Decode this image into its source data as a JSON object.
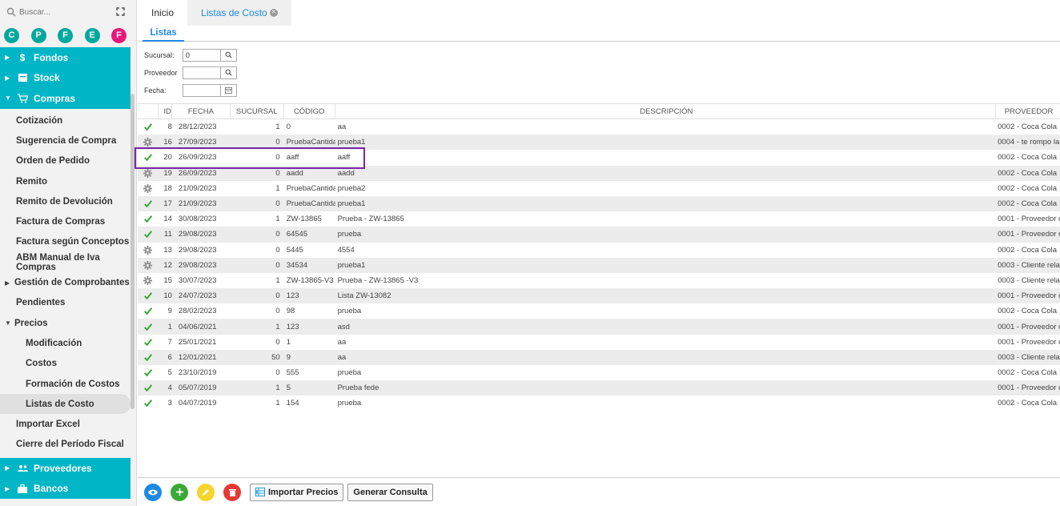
{
  "search": {
    "placeholder": "Buscar..."
  },
  "quick_circles": [
    {
      "letter": "C",
      "color": "#00a99d"
    },
    {
      "letter": "P",
      "color": "#00a99d"
    },
    {
      "letter": "F",
      "color": "#00a99d"
    },
    {
      "letter": "E",
      "color": "#00a99d"
    },
    {
      "letter": "F",
      "color": "#e6187e"
    }
  ],
  "sidebar": {
    "top_groups": [
      {
        "label": "Fondos",
        "icon": "dollar-icon"
      },
      {
        "label": "Stock",
        "icon": "box-icon"
      },
      {
        "label": "Compras",
        "icon": "cart-icon"
      }
    ],
    "compras_items": [
      {
        "label": "Cotización"
      },
      {
        "label": "Sugerencia de Compra"
      },
      {
        "label": "Orden de Pedido"
      },
      {
        "label": "Remito"
      },
      {
        "label": "Remito de Devolución"
      },
      {
        "label": "Factura de Compras"
      },
      {
        "label": "Factura según Conceptos"
      },
      {
        "label": "ABM Manual de Iva Compras"
      },
      {
        "label": "Gestión de Comprobantes"
      },
      {
        "label": "Pendientes"
      },
      {
        "label": "Precios"
      },
      {
        "label": "Modificación"
      },
      {
        "label": "Costos"
      },
      {
        "label": "Formación de Costos"
      },
      {
        "label": "Listas de Costo"
      },
      {
        "label": "Importar Excel"
      },
      {
        "label": "Cierre del Período Fiscal"
      }
    ],
    "bottom_groups": [
      {
        "label": "Proveedores",
        "icon": "people-icon"
      },
      {
        "label": "Bancos",
        "icon": "briefcase-icon"
      }
    ]
  },
  "tabs": {
    "home": "Inicio",
    "active": "Listas de Costo",
    "subtab": "Listas"
  },
  "filters": {
    "sucursal_label": "Sucursal:",
    "sucursal_value": "0",
    "proveedor_label": "Proveedor",
    "proveedor_value": "",
    "fecha_label": "Fecha:",
    "fecha_value": ""
  },
  "table": {
    "headers": {
      "id": "ID",
      "fecha": "FECHA",
      "sucursal": "SUCURSAL",
      "codigo": "CÓDIGO",
      "descripcion": "DESCRIPCIÓN",
      "proveedor": "PROVEEDOR"
    },
    "rows": [
      {
        "status": "check",
        "id": "8",
        "fecha": "28/12/2023",
        "sucursal": "1",
        "codigo": "0",
        "descripcion": "aa",
        "proveedor": "0002 - Coca Cola"
      },
      {
        "status": "gear",
        "id": "16",
        "fecha": "27/09/2023",
        "sucursal": "0",
        "codigo": "PruebaCantida",
        "descripcion": "prueba1",
        "proveedor": "0004 - te rompo la r"
      },
      {
        "status": "check",
        "id": "20",
        "fecha": "26/09/2023",
        "sucursal": "0",
        "codigo": "aaff",
        "descripcion": "aaff",
        "proveedor": "0002 - Coca Cola"
      },
      {
        "status": "gear",
        "id": "19",
        "fecha": "26/09/2023",
        "sucursal": "0",
        "codigo": "aadd",
        "descripcion": "aadd",
        "proveedor": "0002 - Coca Cola"
      },
      {
        "status": "gear",
        "id": "18",
        "fecha": "21/09/2023",
        "sucursal": "1",
        "codigo": "PruebaCantida",
        "descripcion": "prueba2",
        "proveedor": "0002 - Coca Cola"
      },
      {
        "status": "check",
        "id": "17",
        "fecha": "21/09/2023",
        "sucursal": "0",
        "codigo": "PruebaCantida",
        "descripcion": "prueba1",
        "proveedor": "0002 - Coca Cola"
      },
      {
        "status": "check",
        "id": "14",
        "fecha": "30/08/2023",
        "sucursal": "1",
        "codigo": "ZW-13865",
        "descripcion": "Prueba - ZW-13865",
        "proveedor": "0001 - Proveedor de"
      },
      {
        "status": "check",
        "id": "11",
        "fecha": "29/08/2023",
        "sucursal": "0",
        "codigo": "64545",
        "descripcion": "prueba",
        "proveedor": "0001 - Proveedor de"
      },
      {
        "status": "gear",
        "id": "13",
        "fecha": "29/08/2023",
        "sucursal": "0",
        "codigo": "5445",
        "descripcion": "4554",
        "proveedor": "0002 - Coca Cola"
      },
      {
        "status": "gear",
        "id": "12",
        "fecha": "29/08/2023",
        "sucursal": "0",
        "codigo": "34534",
        "descripcion": "prueba1",
        "proveedor": "0003 - Cliente relaci"
      },
      {
        "status": "gear",
        "id": "15",
        "fecha": "30/07/2023",
        "sucursal": "1",
        "codigo": "ZW-13865-V3",
        "descripcion": "Prueba - ZW-13865 -V3",
        "proveedor": "0003 - Cliente relaci"
      },
      {
        "status": "check",
        "id": "10",
        "fecha": "24/07/2023",
        "sucursal": "0",
        "codigo": "123",
        "descripcion": "Lista ZW-13082",
        "proveedor": "0001 - Proveedor de"
      },
      {
        "status": "check",
        "id": "9",
        "fecha": "28/02/2023",
        "sucursal": "0",
        "codigo": "98",
        "descripcion": "prueba",
        "proveedor": "0002 - Coca Cola"
      },
      {
        "status": "check",
        "id": "1",
        "fecha": "04/06/2021",
        "sucursal": "1",
        "codigo": "123",
        "descripcion": "asd",
        "proveedor": "0001 - Proveedor de"
      },
      {
        "status": "check",
        "id": "7",
        "fecha": "25/01/2021",
        "sucursal": "0",
        "codigo": "1",
        "descripcion": "aa",
        "proveedor": "0001 - Proveedor de"
      },
      {
        "status": "check",
        "id": "6",
        "fecha": "12/01/2021",
        "sucursal": "50",
        "codigo": "9",
        "descripcion": "aa",
        "proveedor": "0003 - Cliente relaci"
      },
      {
        "status": "check",
        "id": "5",
        "fecha": "23/10/2019",
        "sucursal": "0",
        "codigo": "555",
        "descripcion": "prueba",
        "proveedor": "0002 - Coca Cola"
      },
      {
        "status": "check",
        "id": "4",
        "fecha": "05/07/2019",
        "sucursal": "1",
        "codigo": "5",
        "descripcion": "Prueba fede",
        "proveedor": "0001 - Proveedor de"
      },
      {
        "status": "check",
        "id": "3",
        "fecha": "04/07/2019",
        "sucursal": "1",
        "codigo": "154",
        "descripcion": "prueba",
        "proveedor": "0002 - Coca Cola"
      }
    ]
  },
  "footer": {
    "import_label": "Importar Precios",
    "query_label": "Generar Consulta"
  },
  "colors": {
    "accent": "#00b6c6",
    "link": "#1e88e5",
    "check": "#3aa935",
    "view": "#1e88e5",
    "add": "#3aa935",
    "edit": "#f5d52a",
    "delete": "#e53935",
    "highlight": "#7a28a8"
  }
}
